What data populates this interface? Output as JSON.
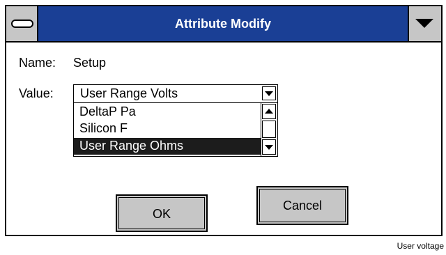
{
  "dialog": {
    "title": "Attribute Modify",
    "name_label": "Name:",
    "name_value": "Setup",
    "value_label": "Value:",
    "selected_value": "User Range Volts",
    "list_items": [
      {
        "label": "DeltaP Pa",
        "selected": false
      },
      {
        "label": "Silicon F",
        "selected": false
      },
      {
        "label": "User Range Ohms",
        "selected": true
      }
    ],
    "ok_label": "OK",
    "cancel_label": "Cancel"
  },
  "caption": "User voltage",
  "colors": {
    "titlebar": "#1a3f95",
    "button_face": "#c6c6c6",
    "selection": "#1c1c1c"
  },
  "icons": {
    "system_menu": "system-menu-icon",
    "window_menu": "triangle-down-icon",
    "dropdown": "chevron-down-icon",
    "scroll_up": "arrow-up-icon",
    "scroll_down": "arrow-down-icon"
  }
}
